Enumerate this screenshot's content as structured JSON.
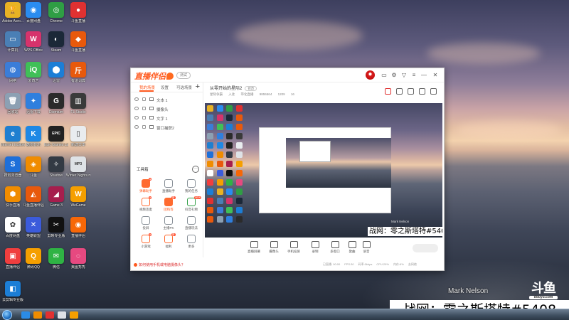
{
  "desktop": {
    "icons": [
      {
        "label": "Adobe Acro...",
        "color": "#e8b224",
        "glyph": "🏆"
      },
      {
        "label": "百度网盘",
        "color": "#2a8cf0",
        "glyph": "◉"
      },
      {
        "label": "Chrome",
        "color": "#2f9e44",
        "glyph": "◎"
      },
      {
        "label": "斗鱼直播",
        "color": "#e03131",
        "glyph": "●"
      },
      {
        "label": "计算机",
        "color": "#4a7fb5",
        "glyph": "▭"
      },
      {
        "label": "WPS Office",
        "color": "#d6336c",
        "glyph": "W"
      },
      {
        "label": "Steam",
        "color": "#1b2838",
        "glyph": "◐"
      },
      {
        "label": "斗鱼直播",
        "color": "#e8590c",
        "glyph": "◆"
      },
      {
        "label": "网络",
        "color": "#3b7dd8",
        "glyph": "◍"
      },
      {
        "label": "爱奇艺",
        "color": "#40c057",
        "glyph": "iQ"
      },
      {
        "label": "迅雷",
        "color": "#1c7ed6",
        "glyph": "⬤"
      },
      {
        "label": "有道词典",
        "color": "#e8590c",
        "glyph": "斤"
      },
      {
        "label": "回收站",
        "color": "#8ca0b3",
        "glyph": "🗑"
      },
      {
        "label": "迅雷下载",
        "color": "#2f7fde",
        "glyph": "✦"
      },
      {
        "label": "Eternium",
        "color": "#2b2b2b",
        "glyph": "G"
      },
      {
        "label": "FL Studio",
        "color": "#3a3a3a",
        "glyph": "▥"
      },
      {
        "label": "Internet Explorer",
        "color": "#1f7fd0",
        "glyph": "e"
      },
      {
        "label": "酷狗音乐",
        "color": "#1e88e5",
        "glyph": "K"
      },
      {
        "label": "Epic Games Launcher",
        "color": "#222222",
        "glyph": "EPIC"
      },
      {
        "label": "新建文本",
        "color": "#e9ecef",
        "glyph": "▯"
      },
      {
        "label": "搜狗浏览器",
        "color": "#1e6fd9",
        "glyph": "S"
      },
      {
        "label": "斗鱼",
        "color": "#f08c00",
        "glyph": "◈"
      },
      {
        "label": "Shadow",
        "color": "#333a44",
        "glyph": "✧"
      },
      {
        "label": "Winter Nights.mp3",
        "color": "#dee2e6",
        "glyph": "MP3"
      },
      {
        "label": "快手直播",
        "color": "#f08c00",
        "glyph": "⬢"
      },
      {
        "label": "斗鱼直播伴侣",
        "color": "#e8590c",
        "glyph": "◭"
      },
      {
        "label": "Game 3",
        "color": "#a61e4d",
        "glyph": "◢"
      },
      {
        "label": "WeGame",
        "color": "#f59f00",
        "glyph": "W"
      },
      {
        "label": "百度网盘",
        "color": "#fff",
        "glyph": "✿"
      },
      {
        "label": "英雄联盟",
        "color": "#3b5bdb",
        "glyph": "✕"
      },
      {
        "label": "剪映专业版",
        "color": "#111",
        "glyph": "✂"
      },
      {
        "label": "直播伴侣",
        "color": "#f76707",
        "glyph": "◉"
      },
      {
        "label": "直播伴侣",
        "color": "#f03e3e",
        "glyph": "▣"
      },
      {
        "label": "腾讯QQ",
        "color": "#f59f00",
        "glyph": "Q"
      },
      {
        "label": "微信",
        "color": "#2fb344",
        "glyph": "✉"
      },
      {
        "label": "美图秀秀",
        "color": "#e64980",
        "glyph": "◌"
      },
      {
        "label": "云剪辑专业版",
        "color": "#1c7ed6",
        "glyph": "◧"
      }
    ]
  },
  "app": {
    "logo_text": "直播伴侣",
    "version_badge": "测试",
    "tabs": [
      "我的场景",
      "设置",
      "可选场景"
    ],
    "sources": [
      "文本 1",
      "摄像头",
      "文字 1",
      "窗口捕获2"
    ],
    "tools_title": "工具箱",
    "tools": [
      {
        "label": "弹幕助手",
        "color": "#ff6a2f",
        "badge": "●",
        "active": true
      },
      {
        "label": "直播助手",
        "color": "#868e96",
        "badge": ""
      },
      {
        "label": "我的任务",
        "color": "#868e96",
        "badge": ""
      },
      {
        "label": "视频连麦",
        "color": "#ff6a2f",
        "badge": "●"
      },
      {
        "label": "团购等",
        "color": "#ff6a2f",
        "badge": "新",
        "active": true
      },
      {
        "label": "抖音礼物",
        "color": "#2f9e44",
        "badge": "NEW"
      },
      {
        "label": "投屏",
        "color": "#868e96",
        "badge": ""
      },
      {
        "label": "主播PK",
        "color": "#868e96",
        "badge": ""
      },
      {
        "label": "直播玩法",
        "color": "#868e96",
        "badge": ""
      },
      {
        "label": "小游戏",
        "color": "#ff6a2f",
        "badge": "●"
      },
      {
        "label": "福利",
        "color": "#ff6a2f",
        "badge": "新"
      },
      {
        "label": "更多",
        "color": "#868e96",
        "badge": ""
      }
    ],
    "notice": "如何使用手机或电脑摄像头？",
    "room": {
      "title": "从零开始的星际2",
      "tag_button": "修改",
      "meta": [
        "星际争霸",
        "入驻",
        "带化直播",
        "9855564",
        "1209",
        "16"
      ]
    },
    "preview": {
      "overlay_label": "战网：零之斯塔特#5408",
      "credit": "Mark Nelson"
    },
    "bottom_tools": [
      "直播屏幕",
      "摄像头",
      "手机投屏",
      "录制",
      "多窗口",
      "歌曲",
      "语音"
    ],
    "status": [
      "已直播: 00:00",
      "FPS:30",
      "码率:0kbps",
      "CPU:29%",
      "内存:6%",
      "去网络"
    ]
  },
  "watermarks": {
    "name": "Mark Nelson",
    "logo_main": "斗鱼",
    "logo_sub": "douyu.com",
    "banner": "战网：零之斯塔特#5408"
  },
  "taskbar": {
    "items": [
      {
        "color": "#2b8be6"
      },
      {
        "color": "#f08c00"
      },
      {
        "color": "#e03131"
      },
      {
        "color": "#dee2e6"
      },
      {
        "color": "#f59f00"
      }
    ]
  }
}
